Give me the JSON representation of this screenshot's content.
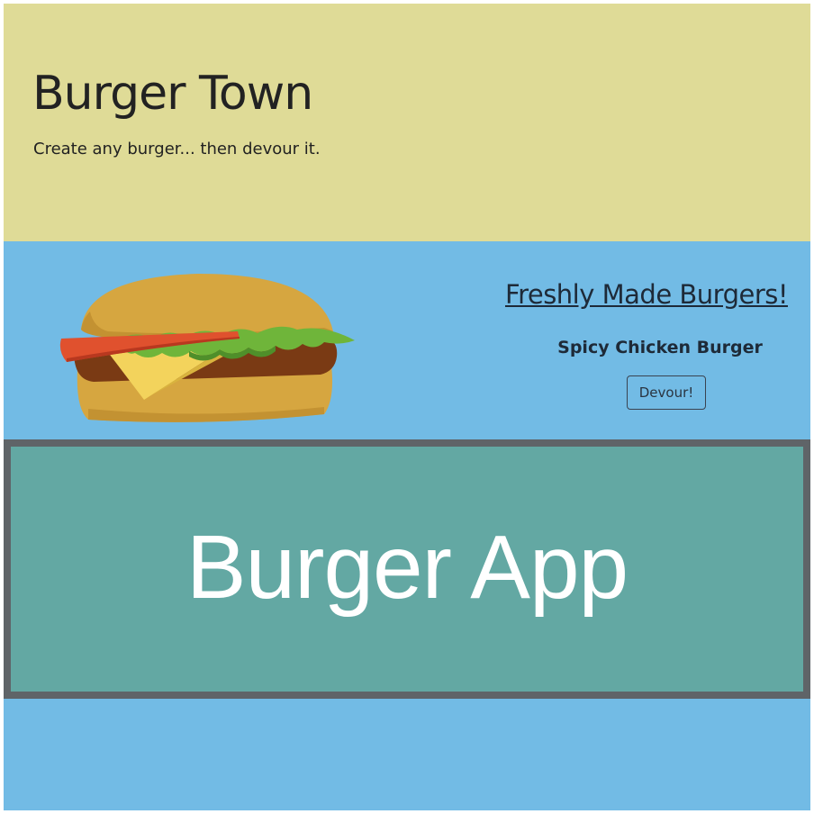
{
  "header": {
    "title": "Burger Town",
    "tagline": "Create any burger... then devour it."
  },
  "menu": {
    "heading": "Freshly Made Burgers!",
    "burgers": [
      {
        "name": "Spicy Chicken Burger",
        "action_label": "Devour!"
      }
    ]
  },
  "banner": {
    "text": "Burger App"
  },
  "colors": {
    "jumbotron": "#dfdb97",
    "page_background": "#72bbe5",
    "banner": "#63a8a3",
    "banner_border": "#5f6468"
  },
  "illustration": "burger-image"
}
